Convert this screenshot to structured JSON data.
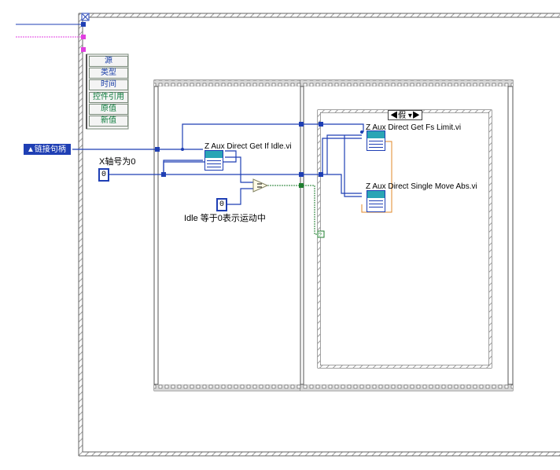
{
  "event_tabs": [
    {
      "label": "源",
      "color": "blue"
    },
    {
      "label": "类型",
      "color": "blue"
    },
    {
      "label": "时间",
      "color": "blue"
    },
    {
      "label": "控件引用",
      "color": "green"
    },
    {
      "label": "原值",
      "color": "green"
    },
    {
      "label": "新值",
      "color": "green"
    }
  ],
  "controls": {
    "link_handle_label": "链接句柄",
    "x_axis_label": "X轴号为0",
    "x_axis_value": "0",
    "idle_const_value": "0",
    "idle_note": "Idle 等于0表示运动中"
  },
  "subvis": {
    "get_idle": "Z Aux Direct Get If Idle.vi",
    "get_fs_limit": "Z Aux Direct Get Fs Limit.vi",
    "single_move_abs": "Z Aux Direct Single Move Abs.vi"
  },
  "case_selector": {
    "value": "假"
  },
  "colors": {
    "wire_blue": "#1f3fb4",
    "wire_green": "#1e7d2e",
    "wire_pink": "#e040e0",
    "frame_gray": "#808080"
  }
}
